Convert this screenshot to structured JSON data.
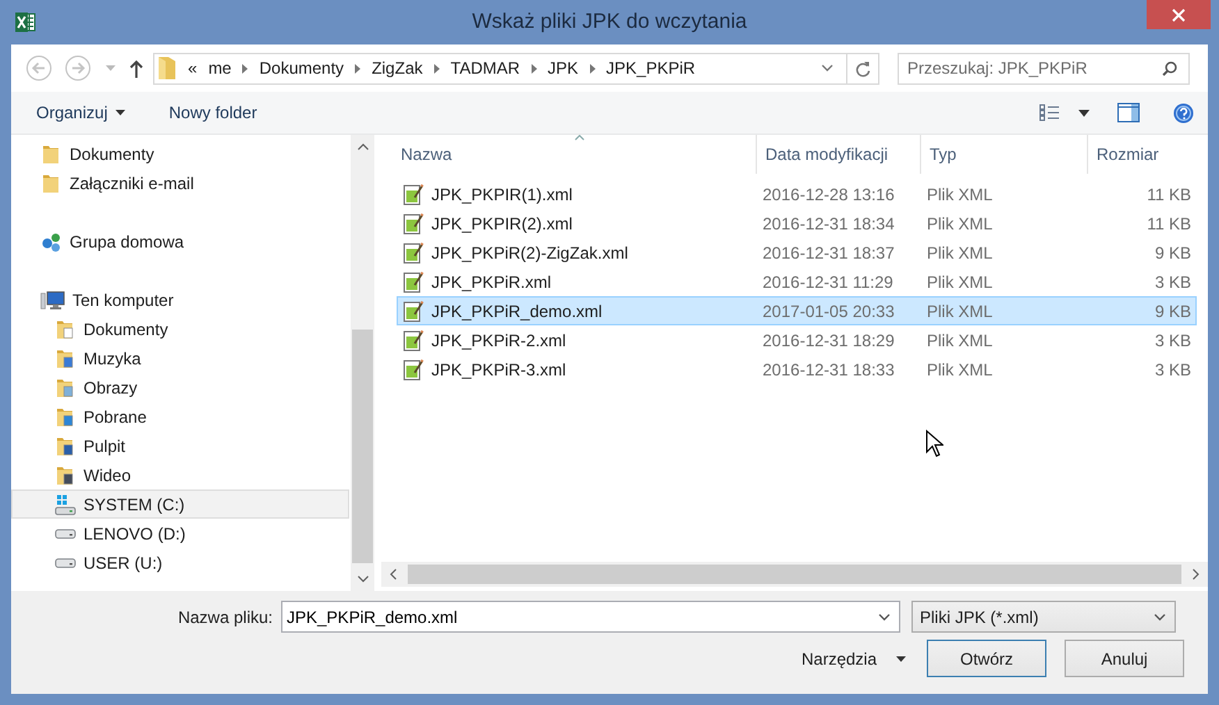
{
  "window": {
    "title": "Wskaż pliki JPK do wczytania"
  },
  "navigation": {
    "back": {
      "disabled": true
    },
    "forward": {
      "disabled": true
    }
  },
  "address": {
    "overflow_mark": "«",
    "path": [
      "me",
      "Dokumenty",
      "ZigZak",
      "TADMAR",
      "JPK",
      "JPK_PKPiR"
    ]
  },
  "search": {
    "placeholder": "Przeszukaj: JPK_PKPiR"
  },
  "toolbar": {
    "organize": "Organizuj",
    "new_folder": "Nowy folder"
  },
  "sidebar": {
    "items": [
      {
        "children": [
          {
            "label": "Dokumenty",
            "kind": "folder",
            "selected": false
          },
          {
            "label": "Załączniki e-mail",
            "kind": "folder",
            "selected": false
          }
        ]
      },
      {
        "label": "Grupa domowa",
        "kind": "homegroup",
        "selected": false
      },
      {
        "label": "Ten komputer",
        "kind": "computer",
        "selected": false,
        "children": [
          {
            "label": "Dokumenty",
            "kind": "documents",
            "selected": false
          },
          {
            "label": "Muzyka",
            "kind": "music",
            "selected": false
          },
          {
            "label": "Obrazy",
            "kind": "pictures",
            "selected": false
          },
          {
            "label": "Pobrane",
            "kind": "downloads",
            "selected": false
          },
          {
            "label": "Pulpit",
            "kind": "desktop",
            "selected": false
          },
          {
            "label": "Wideo",
            "kind": "videos",
            "selected": false
          },
          {
            "label": "SYSTEM (C:)",
            "kind": "system",
            "selected": true
          },
          {
            "label": "LENOVO (D:)",
            "kind": "drive",
            "selected": false
          },
          {
            "label": "USER (U:)",
            "kind": "drive",
            "selected": false
          }
        ]
      }
    ]
  },
  "file_list": {
    "columns": [
      {
        "label": "Nazwa",
        "sorted": true
      },
      {
        "label": "Data modyfikacji",
        "sorted": false
      },
      {
        "label": "Typ",
        "sorted": false
      },
      {
        "label": "Rozmiar",
        "sorted": false
      }
    ],
    "rows": [
      {
        "name": "JPK_PKPIR(1).xml",
        "modified": "2016-12-28 13:16",
        "type": "Plik XML",
        "size": "11 KB",
        "selected": false
      },
      {
        "name": "JPK_PKPIR(2).xml",
        "modified": "2016-12-31 18:34",
        "type": "Plik XML",
        "size": "11 KB",
        "selected": false
      },
      {
        "name": "JPK_PKPiR(2)-ZigZak.xml",
        "modified": "2016-12-31 18:37",
        "type": "Plik XML",
        "size": "9 KB",
        "selected": false
      },
      {
        "name": "JPK_PKPiR.xml",
        "modified": "2016-12-31 11:29",
        "type": "Plik XML",
        "size": "3 KB",
        "selected": false
      },
      {
        "name": "JPK_PKPiR_demo.xml",
        "modified": "2017-01-05 20:33",
        "type": "Plik XML",
        "size": "9 KB",
        "selected": true
      },
      {
        "name": "JPK_PKPiR-2.xml",
        "modified": "2016-12-31 18:29",
        "type": "Plik XML",
        "size": "3 KB",
        "selected": false
      },
      {
        "name": "JPK_PKPiR-3.xml",
        "modified": "2016-12-31 18:33",
        "type": "Plik XML",
        "size": "3 KB",
        "selected": false
      }
    ]
  },
  "footer": {
    "filename_label": "Nazwa pliku:",
    "filename": "JPK_PKPiR_demo.xml",
    "filter": "Pliki JPK (*.xml)",
    "tools": "Narzędzia",
    "open": "Otwórz",
    "cancel": "Anuluj"
  }
}
